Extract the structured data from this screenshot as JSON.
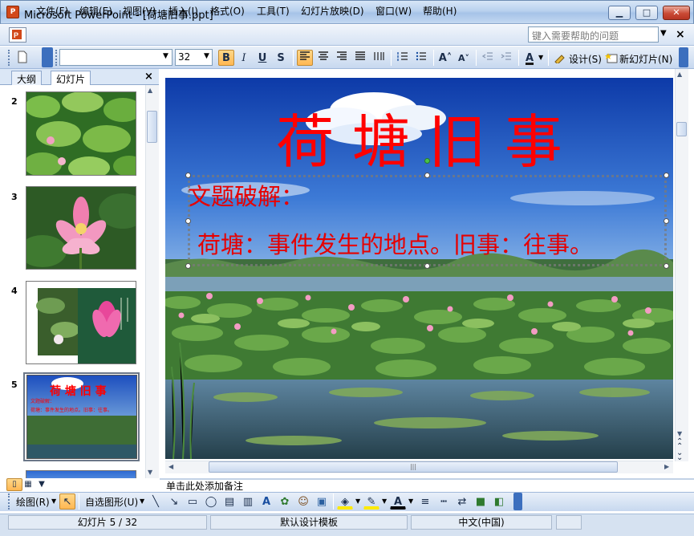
{
  "window": {
    "title": "Microsoft PowerPoint - [荷塘旧事.ppt]",
    "app_icon": "P",
    "min": "▁",
    "max": "□",
    "close": "✕"
  },
  "menu": {
    "items": [
      "文件(F)",
      "编辑(E)",
      "视图(V)",
      "插入(I)",
      "格式(O)",
      "工具(T)",
      "幻灯片放映(D)",
      "窗口(W)",
      "帮助(H)"
    ],
    "help_placeholder": "键入需要帮助的问题",
    "help_arrow": "▼",
    "close_doc": "×"
  },
  "toolbar": {
    "font_name": "",
    "font_size": "32",
    "bold": "B",
    "italic": "I",
    "underline": "U",
    "shadow": "S",
    "increase_font": "A˄",
    "decrease_font": "A˅",
    "font_color": "A",
    "design_label": "设计(S)",
    "new_slide_label": "新幻灯片(N)"
  },
  "left_pane": {
    "tabs": [
      "大纲",
      "幻灯片"
    ],
    "close": "×",
    "slides": [
      {
        "num": "2"
      },
      {
        "num": "3"
      },
      {
        "num": "4"
      },
      {
        "num": "5",
        "mini_title": "荷 塘 旧 事",
        "mini_line1": "文题破解：",
        "mini_line2": "荷塘：事件发生的地点。旧事：往事。"
      }
    ]
  },
  "slide": {
    "title": "荷 塘 旧 事",
    "line1": "文题破解：",
    "line2": "荷塘：事件发生的地点。旧事：往事。",
    "title_color": "#ff0000",
    "text_color": "#e60000"
  },
  "notes": {
    "placeholder": "单击此处添加备注"
  },
  "drawbar": {
    "draw_label": "绘图(R)",
    "autoshapes_label": "自选图形(U)"
  },
  "status": {
    "slide_info": "幻灯片 5 / 32",
    "template": "默认设计模板",
    "language": "中文(中国)"
  }
}
